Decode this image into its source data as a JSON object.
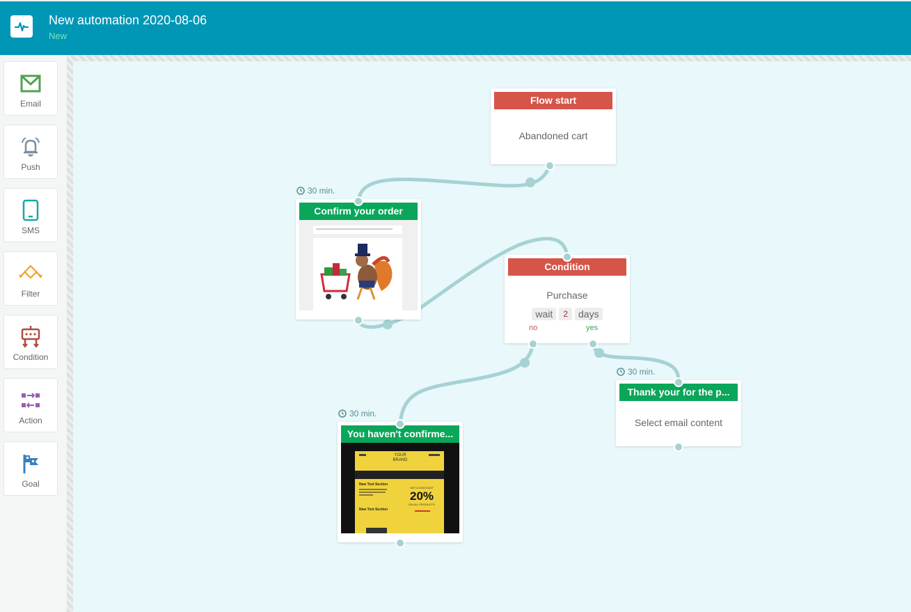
{
  "header": {
    "title": "New automation 2020-08-06",
    "status": "New"
  },
  "sidebar": {
    "items": [
      {
        "label": "Email",
        "icon": "envelope-icon",
        "color": "#4ea34e"
      },
      {
        "label": "Push",
        "icon": "bell-icon",
        "color": "#7b8ea0"
      },
      {
        "label": "SMS",
        "icon": "tablet-icon",
        "color": "#1aa6a6"
      },
      {
        "label": "Filter",
        "icon": "filter-icon",
        "color": "#f0a020"
      },
      {
        "label": "Condition",
        "icon": "condition-icon",
        "color": "#b04a40"
      },
      {
        "label": "Action",
        "icon": "action-icon",
        "color": "#9a5db5"
      },
      {
        "label": "Goal",
        "icon": "flag-icon",
        "color": "#3a80c0"
      }
    ]
  },
  "nodes": {
    "flow_start": {
      "title": "Flow start",
      "body": "Abandoned cart"
    },
    "confirm_order": {
      "title": "Confirm your order",
      "delay": "30 min."
    },
    "condition": {
      "title": "Condition",
      "body": "Purchase",
      "wait_label": "wait",
      "wait_value": "2",
      "wait_unit": "days",
      "no_label": "no",
      "yes_label": "yes"
    },
    "not_confirmed": {
      "title": "You haven't confirme...",
      "delay": "30 min."
    },
    "thank_you": {
      "title": "Thank your for the p...",
      "delay": "30 min.",
      "body": "Select email content"
    }
  },
  "thumbnail": {
    "brand": "YOUR\nBRAND",
    "section1": "New Text Section",
    "discount_label": "GET A DISCOUNT",
    "discount": "20%",
    "discount_sub": "ON ALL PRODUCTS",
    "section2": "New Text Section"
  },
  "colors": {
    "header": "#0097b7",
    "node_red": "#d65549",
    "node_green": "#0aa65a",
    "edge": "#a6d2d4",
    "canvas": "#e9f8fa"
  }
}
